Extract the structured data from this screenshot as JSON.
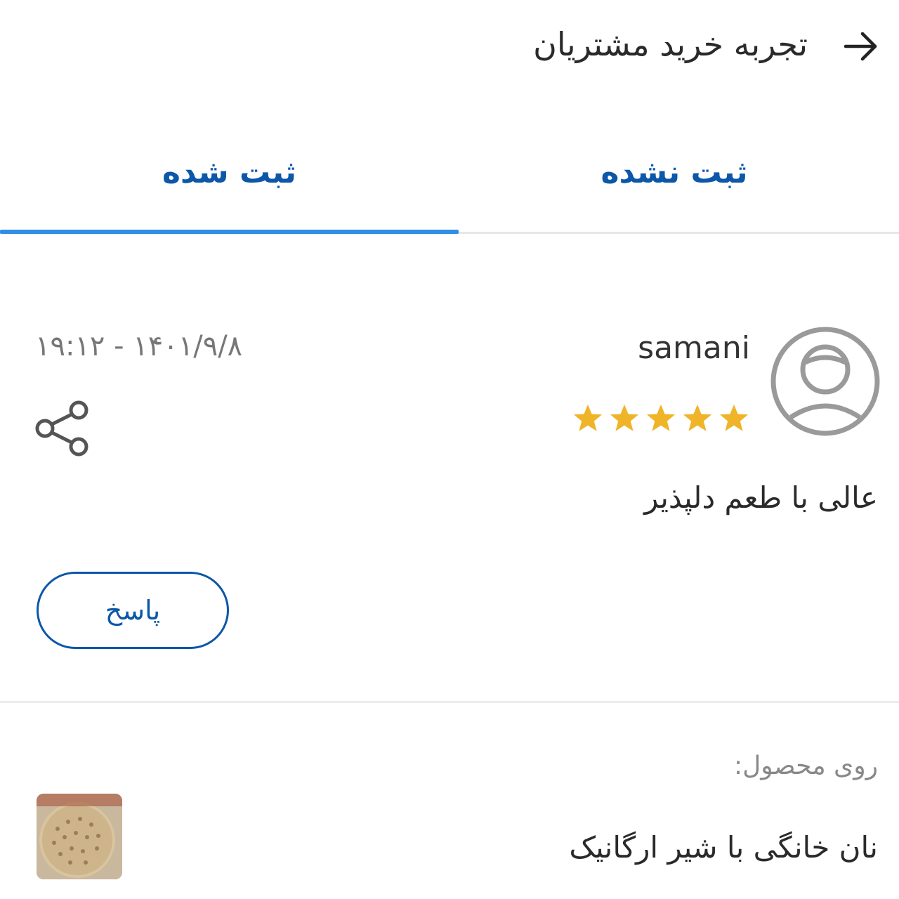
{
  "header": {
    "title": "تجربه خرید مشتریان",
    "back_icon": "arrow-right-icon"
  },
  "tabs": [
    {
      "label": "ثبت نشده",
      "active": false
    },
    {
      "label": "ثبت شده",
      "active": true
    }
  ],
  "colors": {
    "brand": "#0c57a8",
    "tab_indicator": "#2f8ee6",
    "star": "#f0b429",
    "avatar": "#9a9a9a"
  },
  "review": {
    "username": "samani",
    "rating": 5,
    "rating_max": 5,
    "date": "۱۴۰۱/۹/۸ - ۱۹:۱۲",
    "comment": "عالی با طعم دلپذیر",
    "reply_label": "پاسخ",
    "share_icon": "share-icon",
    "avatar_icon": "user-avatar-icon"
  },
  "product": {
    "on_product_label": "روی محصول:",
    "name": "نان خانگی با شیر ارگانیک"
  }
}
